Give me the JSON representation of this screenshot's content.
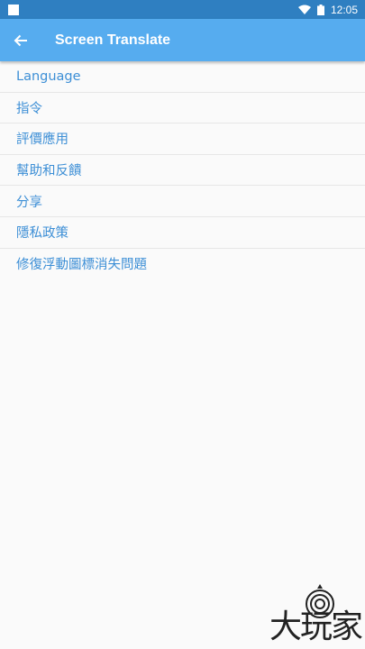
{
  "status_bar": {
    "time": "12:05"
  },
  "app_bar": {
    "title": "Screen Translate"
  },
  "menu": {
    "items": [
      {
        "label": "Language"
      },
      {
        "label": "指令"
      },
      {
        "label": "評價應用"
      },
      {
        "label": "幫助和反饋"
      },
      {
        "label": "分享"
      },
      {
        "label": "隱私政策"
      },
      {
        "label": "修復浮動圖標消失問題"
      }
    ]
  },
  "watermark": {
    "text": "大玩家"
  },
  "colors": {
    "status_bar": "#2f7fc1",
    "app_bar": "#56acef",
    "menu_text": "#3d8fd6",
    "background": "#fafafa"
  },
  "icons": {
    "back": "arrow-back-icon",
    "wifi": "wifi-icon",
    "battery": "battery-icon",
    "notification": "notification-square-icon"
  }
}
